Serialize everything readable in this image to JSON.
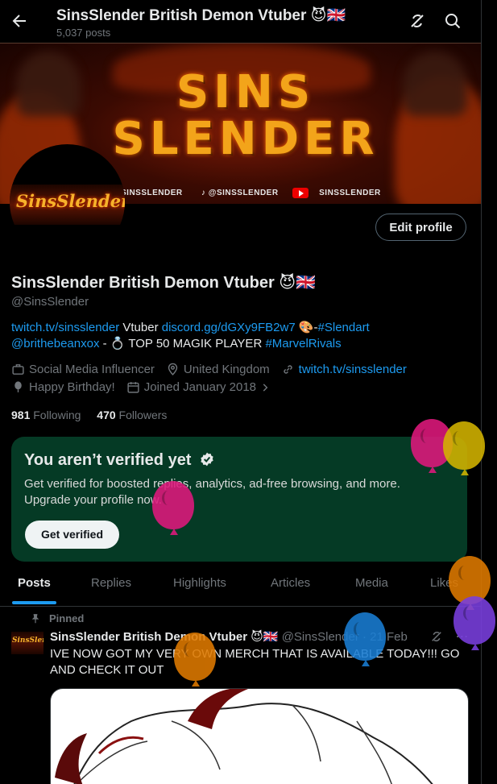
{
  "header": {
    "title": "SinsSlender British Demon Vtuber 😈🇬🇧",
    "posts_count": "5,037 posts"
  },
  "banner": {
    "logo_text_line1": "SINS",
    "logo_text_line2": "SLENDER",
    "social_twitch": "SINSSLENDER",
    "social_tiktok": "@SINSSLENDER",
    "social_youtube": "SINSSLENDER"
  },
  "avatar": {
    "logo_text": "SinsSlender"
  },
  "profile": {
    "edit_button": "Edit profile",
    "name": "SinsSlender British Demon Vtuber 😈🇬🇧",
    "handle": "@SinsSlender",
    "bio": {
      "link1": "twitch.tv/sinsslender",
      "text1": " Vtuber ",
      "link2": "discord.gg/dGXy9FB2w7",
      "text2": " 🎨-",
      "hashtag1": "#Slendart",
      "mention": "@brithebeanxox",
      "text3": " - 💍 TOP 50 MAGIK PLAYER ",
      "hashtag2": "#MarvelRivals"
    },
    "category": "Social Media Influencer",
    "location": "United Kingdom",
    "website": "twitch.tv/sinsslender",
    "birthday": "Happy Birthday!",
    "joined": "Joined January 2018",
    "following_count": "981",
    "following_label": "Following",
    "followers_count": "470",
    "followers_label": "Followers"
  },
  "verify": {
    "title": "You aren’t verified yet",
    "description": "Get verified for boosted replies, analytics, ad-free browsing, and more. Upgrade your profile now.",
    "button": "Get verified"
  },
  "tabs": [
    "Posts",
    "Replies",
    "Highlights",
    "Articles",
    "Media",
    "Likes"
  ],
  "post": {
    "pinned_label": "Pinned",
    "author": "SinsSlender British Demon Vtuber 😈🇬🇧",
    "handle": "@SinsSlender",
    "date": "· 21 Feb",
    "text": "IVE NOW GOT MY VERY OWN MERCH THAT IS AVAILABLE TODAY!!! GO AND CHECK IT OUT",
    "avatar_text": "SinsSlender"
  },
  "colors": {
    "accent": "#1d9bf0",
    "verify_bg": "#053a25",
    "balloons": [
      "#e0197d",
      "#d4b400",
      "#e0197d",
      "#e07a00",
      "#7a3fe0",
      "#1a7ed4",
      "#e07a00"
    ]
  }
}
